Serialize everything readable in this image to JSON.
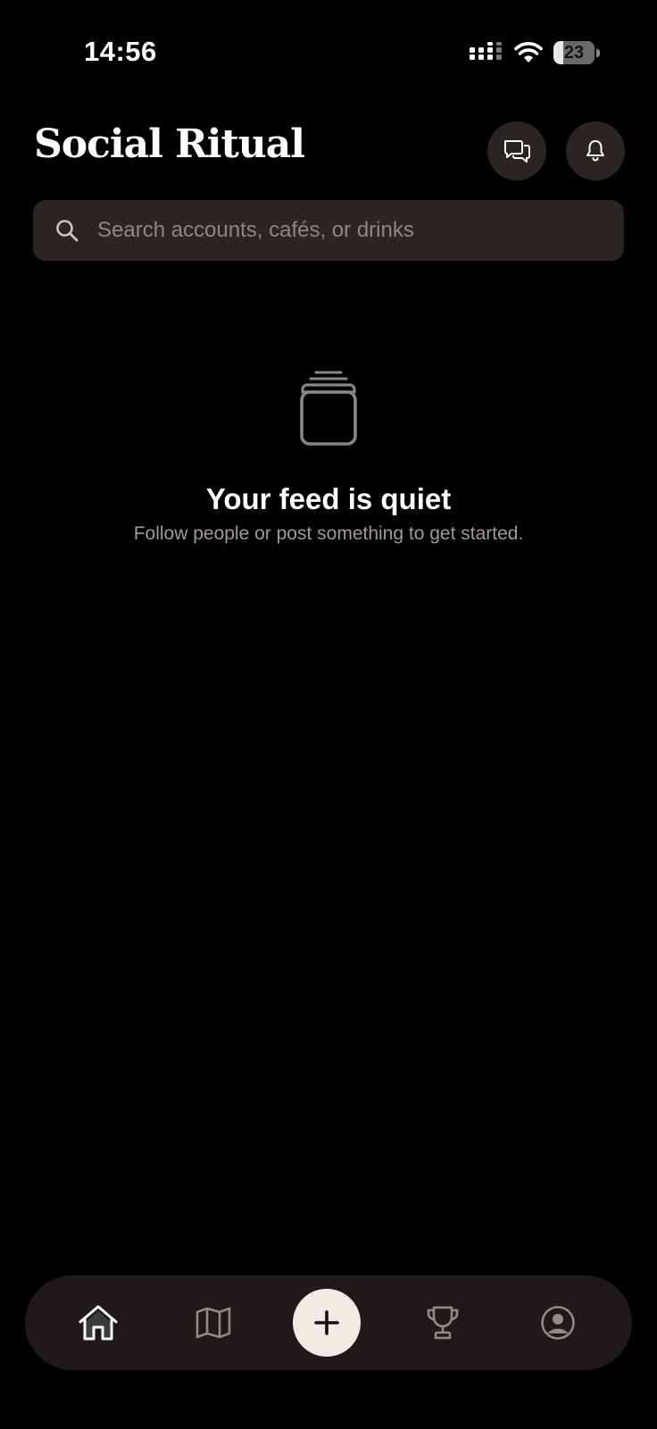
{
  "status_bar": {
    "time": "14:56",
    "battery": 23,
    "icons": [
      "signal-icon",
      "wifi-icon",
      "battery-icon"
    ]
  },
  "header": {
    "title": "Social Ritual",
    "buttons": [
      {
        "name": "messages-button",
        "icon": "chat-bubbles-icon"
      },
      {
        "name": "notifications-button",
        "icon": "bell-icon"
      }
    ]
  },
  "search": {
    "placeholder": "Search accounts, cafés, or drinks",
    "icon": "search-icon"
  },
  "empty_state": {
    "icon": "empty-jar-icon",
    "title": "Your feed is quiet",
    "subtitle": "Follow people or post something to get started."
  },
  "bottom_nav": {
    "items": [
      {
        "icon": "home-icon",
        "active": true
      },
      {
        "icon": "map-icon",
        "active": false
      },
      {
        "icon": "plus-icon",
        "active": false
      },
      {
        "icon": "trophy-icon",
        "active": false
      },
      {
        "icon": "profile-icon",
        "active": false
      }
    ]
  },
  "colors": {
    "background": "#000000",
    "surface": "#2b2623",
    "nav_background": "#1d1a19",
    "post_button": "#f0ebe5",
    "muted_text": "#a09a97"
  }
}
